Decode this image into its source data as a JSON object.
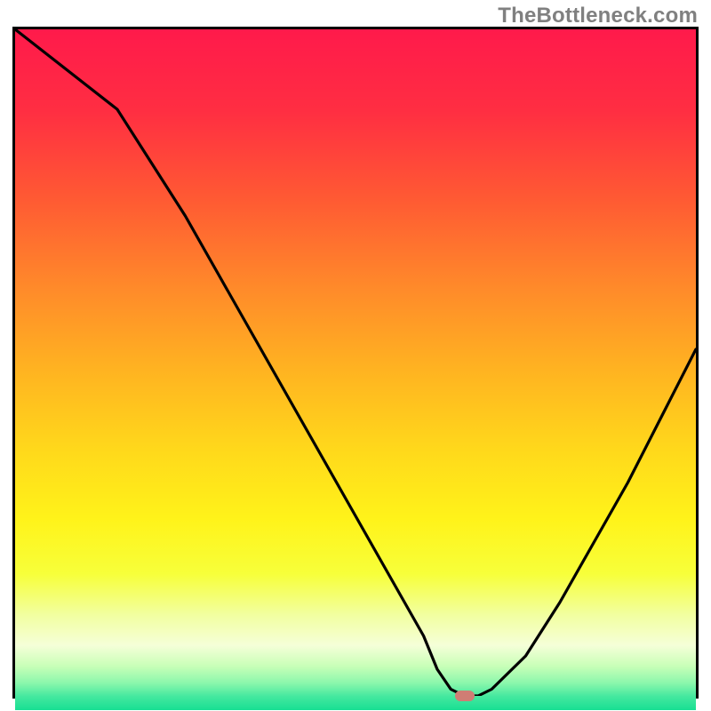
{
  "watermark": "TheBottleneck.com",
  "colors": {
    "border": "#000000",
    "curve": "#000000",
    "marker": "#cf7d74",
    "gradient_stops": [
      {
        "offset": 0.0,
        "color": "#ff1a4b"
      },
      {
        "offset": 0.12,
        "color": "#ff2e42"
      },
      {
        "offset": 0.25,
        "color": "#ff5a33"
      },
      {
        "offset": 0.38,
        "color": "#ff8a2a"
      },
      {
        "offset": 0.5,
        "color": "#ffb321"
      },
      {
        "offset": 0.62,
        "color": "#ffd91b"
      },
      {
        "offset": 0.72,
        "color": "#fff31a"
      },
      {
        "offset": 0.8,
        "color": "#f7ff3a"
      },
      {
        "offset": 0.86,
        "color": "#f2ffa0"
      },
      {
        "offset": 0.905,
        "color": "#f5ffd8"
      },
      {
        "offset": 0.935,
        "color": "#c9ffb8"
      },
      {
        "offset": 0.96,
        "color": "#8cf7ac"
      },
      {
        "offset": 0.98,
        "color": "#44e89f"
      },
      {
        "offset": 1.0,
        "color": "#18df93"
      }
    ]
  },
  "chart_data": {
    "type": "line",
    "title": "",
    "xlabel": "",
    "ylabel": "",
    "xlim": [
      0,
      100
    ],
    "ylim": [
      0,
      100
    ],
    "x": [
      0,
      5,
      10,
      15,
      20,
      25,
      30,
      35,
      40,
      45,
      50,
      55,
      60,
      62,
      64,
      66,
      68,
      70,
      75,
      80,
      85,
      90,
      95,
      100
    ],
    "values": [
      100,
      96,
      92,
      88,
      80,
      72,
      63,
      54,
      45,
      36,
      27,
      18,
      9,
      4,
      1,
      0,
      0,
      1,
      6,
      14,
      23,
      32,
      42,
      52
    ],
    "marker": {
      "x": 66,
      "y": 0
    },
    "note": "Values are estimated from the plotted curve; 0 = bottom (green), 100 = top (red)."
  }
}
